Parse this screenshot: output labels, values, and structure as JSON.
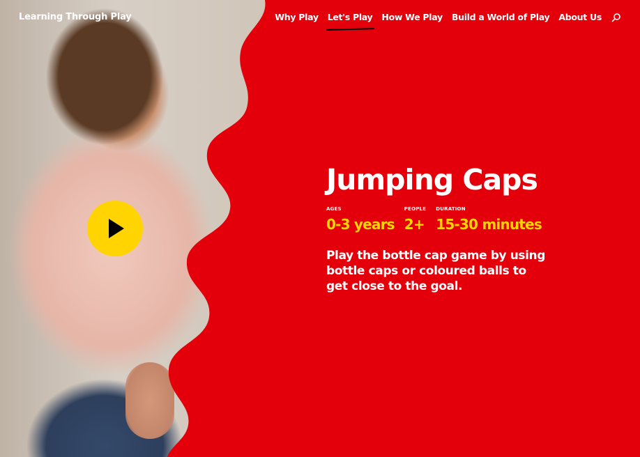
{
  "header": {
    "logo": "Learning Through Play",
    "nav": [
      {
        "label": "Why Play"
      },
      {
        "label": "Let's Play",
        "active": true
      },
      {
        "label": "How We Play"
      },
      {
        "label": "Build a World of Play"
      },
      {
        "label": "About Us"
      }
    ],
    "search_icon": "search-icon"
  },
  "hero": {
    "play_icon": "play-icon",
    "title": "Jumping Caps",
    "meta": {
      "ages_label": "AGES",
      "ages_value": "0-3 years",
      "people_label": "PEOPLE",
      "people_value": "2+",
      "duration_label": "DURATION",
      "duration_value": "15-30 minutes"
    },
    "description": "Play the bottle cap game by using bottle caps or coloured balls to get close to the goal."
  },
  "colors": {
    "brand_red": "#e3000b",
    "accent_yellow": "#ffd400",
    "text_white": "#ffffff"
  }
}
